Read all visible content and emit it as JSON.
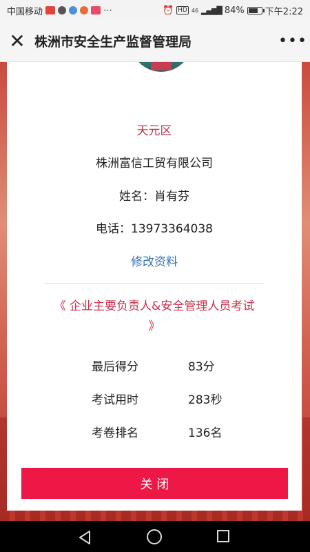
{
  "status_bar": {
    "carrier": "中国移动",
    "network": "46",
    "battery": "84%",
    "battery_level": 0.84,
    "time": "下午2:22"
  },
  "title_bar": {
    "title": "株洲市安全生产监督管理局"
  },
  "profile": {
    "district": "天元区",
    "company": "株洲富信工贸有限公司",
    "name_line": "姓名：肖有芬",
    "phone_line": "电话：13973364038",
    "edit_label": "修改资料"
  },
  "exam": {
    "title": "《 企业主要负责人&安全管理人员考试 》",
    "rows": [
      {
        "label": "最后得分",
        "value": "83分"
      },
      {
        "label": "考试用时",
        "value": "283秒"
      },
      {
        "label": "考卷排名",
        "value": "136名"
      }
    ]
  },
  "close_button": {
    "label": "关 闭"
  },
  "colors": {
    "accent_red": "#ee1846",
    "district_red": "#c0304a",
    "link_blue": "#3a73b7"
  },
  "icons": {
    "close": "close-icon",
    "more": "more-icon",
    "alarm": "alarm-icon",
    "signal": "signal-icon",
    "battery": "battery-icon",
    "nav_back": "back-triangle-icon",
    "nav_home": "home-circle-icon",
    "nav_recent": "recent-square-icon"
  }
}
